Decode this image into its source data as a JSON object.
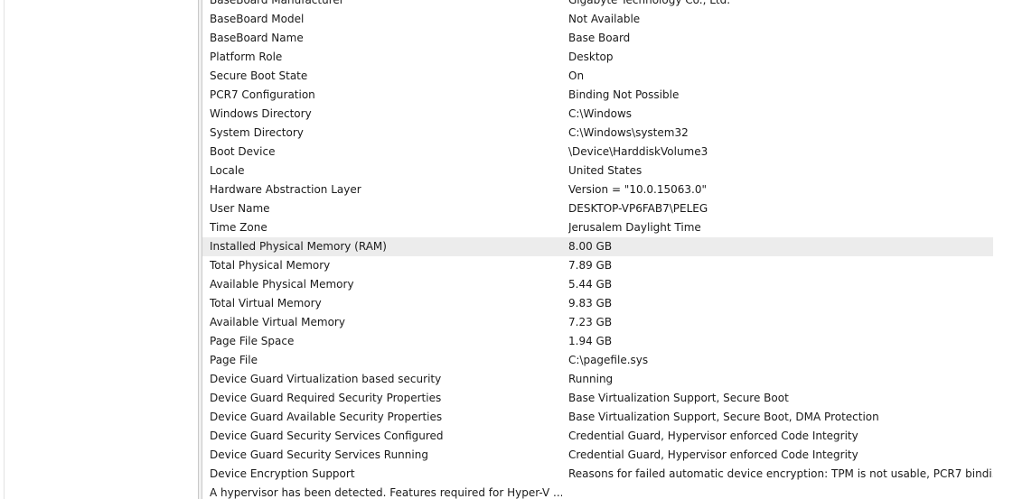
{
  "rows": [
    {
      "item": "BaseBoard Manufacturer",
      "value": "Gigabyte Technology Co., Ltd."
    },
    {
      "item": "BaseBoard Model",
      "value": "Not Available"
    },
    {
      "item": "BaseBoard Name",
      "value": "Base Board"
    },
    {
      "item": "Platform Role",
      "value": "Desktop"
    },
    {
      "item": "Secure Boot State",
      "value": "On"
    },
    {
      "item": "PCR7 Configuration",
      "value": "Binding Not Possible"
    },
    {
      "item": "Windows Directory",
      "value": "C:\\Windows"
    },
    {
      "item": "System Directory",
      "value": "C:\\Windows\\system32"
    },
    {
      "item": "Boot Device",
      "value": "\\Device\\HarddiskVolume3"
    },
    {
      "item": "Locale",
      "value": "United States"
    },
    {
      "item": "Hardware Abstraction Layer",
      "value": "Version = \"10.0.15063.0\""
    },
    {
      "item": "User Name",
      "value": "DESKTOP-VP6FAB7\\PELEG"
    },
    {
      "item": "Time Zone",
      "value": "Jerusalem Daylight Time"
    },
    {
      "item": "Installed Physical Memory (RAM)",
      "value": "8.00 GB",
      "selected": true
    },
    {
      "item": "Total Physical Memory",
      "value": "7.89 GB"
    },
    {
      "item": "Available Physical Memory",
      "value": "5.44 GB"
    },
    {
      "item": "Total Virtual Memory",
      "value": "9.83 GB"
    },
    {
      "item": "Available Virtual Memory",
      "value": "7.23 GB"
    },
    {
      "item": "Page File Space",
      "value": "1.94 GB"
    },
    {
      "item": "Page File",
      "value": "C:\\pagefile.sys"
    },
    {
      "item": "Device Guard Virtualization based security",
      "value": "Running"
    },
    {
      "item": "Device Guard Required Security Properties",
      "value": "Base Virtualization Support, Secure Boot"
    },
    {
      "item": "Device Guard Available Security Properties",
      "value": "Base Virtualization Support, Secure Boot, DMA Protection"
    },
    {
      "item": "Device Guard Security Services Configured",
      "value": "Credential Guard, Hypervisor enforced Code Integrity"
    },
    {
      "item": "Device Guard Security Services Running",
      "value": "Credential Guard, Hypervisor enforced Code Integrity"
    },
    {
      "item": "Device Encryption Support",
      "value": "Reasons for failed automatic device encryption: TPM is not usable, PCR7 bindi..."
    },
    {
      "item": "A hypervisor has been detected. Features required for Hyper-V ...",
      "value": ""
    }
  ]
}
